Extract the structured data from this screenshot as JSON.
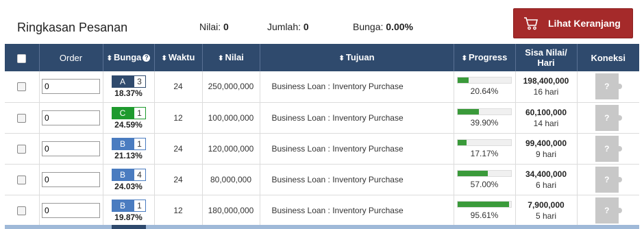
{
  "summary": {
    "title": "Ringkasan Pesanan",
    "nilai_label": "Nilai:",
    "nilai_value": "0",
    "jumlah_label": "Jumlah:",
    "jumlah_value": "0",
    "bunga_label": "Bunga:",
    "bunga_value": "0.00%",
    "cart_button": "Lihat Keranjang",
    "cart_icon": "shopping-cart-icon"
  },
  "table": {
    "headers": {
      "order": "Order",
      "bunga": "Bunga",
      "waktu": "Waktu",
      "nilai": "Nilai",
      "tujuan": "Tujuan",
      "progress": "Progress",
      "sisa_line1": "Sisa Nilai/",
      "sisa_line2": "Hari",
      "koneksi": "Koneksi"
    },
    "rows": [
      {
        "order": "0",
        "grade": "A",
        "grade_num": "3",
        "grade_color": "#2f4a6d",
        "rate": "18.37%",
        "waktu": "24",
        "nilai": "250,000,000",
        "tujuan": "Business Loan : Inventory Purchase",
        "progress": 20.64,
        "progress_text": "20.64%",
        "sisa": "198,400,000",
        "hari": "16 hari",
        "koneksi": "?"
      },
      {
        "order": "0",
        "grade": "C",
        "grade_num": "1",
        "grade_color": "#1e9a2e",
        "rate": "24.59%",
        "waktu": "12",
        "nilai": "100,000,000",
        "tujuan": "Business Loan : Inventory Purchase",
        "progress": 39.9,
        "progress_text": "39.90%",
        "sisa": "60,100,000",
        "hari": "14 hari",
        "koneksi": "?"
      },
      {
        "order": "0",
        "grade": "B",
        "grade_num": "1",
        "grade_color": "#4a7cc0",
        "rate": "21.13%",
        "waktu": "24",
        "nilai": "120,000,000",
        "tujuan": "Business Loan : Inventory Purchase",
        "progress": 17.17,
        "progress_text": "17.17%",
        "sisa": "99,400,000",
        "hari": "9 hari",
        "koneksi": "?"
      },
      {
        "order": "0",
        "grade": "B",
        "grade_num": "4",
        "grade_color": "#4a7cc0",
        "rate": "24.03%",
        "waktu": "24",
        "nilai": "80,000,000",
        "tujuan": "Business Loan : Inventory Purchase",
        "progress": 57.0,
        "progress_text": "57.00%",
        "sisa": "34,400,000",
        "hari": "6 hari",
        "koneksi": "?"
      },
      {
        "order": "0",
        "grade": "B",
        "grade_num": "1",
        "grade_color": "#4a7cc0",
        "rate": "19.87%",
        "waktu": "12",
        "nilai": "180,000,000",
        "tujuan": "Business Loan : Inventory Purchase",
        "progress": 95.61,
        "progress_text": "95.61%",
        "sisa": "7,900,000",
        "hari": "5 hari",
        "koneksi": "?"
      }
    ]
  },
  "colors": {
    "header_bg": "#2f4a6d",
    "cart_button_bg": "#a52a2a",
    "progress_fill": "#3a9a3a",
    "puzzle_gray": "#c8c8c8"
  }
}
